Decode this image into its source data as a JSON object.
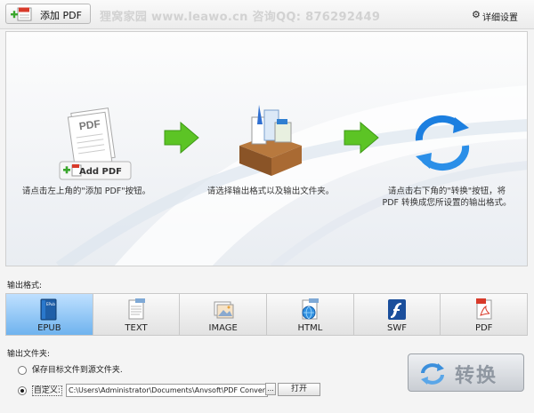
{
  "toolbar": {
    "add_pdf_label": "添加 PDF",
    "watermark": "狸窝家园 www.leawo.cn   咨询QQ: 876292449",
    "settings_label": "详细设置"
  },
  "steps": {
    "step1_icon_label": "Add PDF",
    "step1_text": "请点击左上角的\"添加 PDF\"按钮。",
    "step2_text": "请选择输出格式以及输出文件夹。",
    "step3_text_line1": "请点击右下角的\"转换\"按钮，将",
    "step3_text_line2": "PDF 转换成您所设置的输出格式。"
  },
  "format": {
    "section_label": "输出格式:",
    "selected": "EPUB",
    "tabs": [
      {
        "label": "EPUB",
        "icon": "epub-book-icon"
      },
      {
        "label": "TEXT",
        "icon": "text-document-icon"
      },
      {
        "label": "IMAGE",
        "icon": "image-icon"
      },
      {
        "label": "HTML",
        "icon": "html-globe-icon"
      },
      {
        "label": "SWF",
        "icon": "flash-icon"
      },
      {
        "label": "PDF",
        "icon": "pdf-document-icon"
      }
    ]
  },
  "output": {
    "section_label": "输出文件夹:",
    "option_same_folder": "保存目标文件到源文件夹.",
    "option_custom": "自定义:",
    "selected_option": "custom",
    "path": "C:\\Users\\Administrator\\Documents\\Anvsoft\\PDF Converter\\output\\",
    "browse_label": "...",
    "open_label": "打开"
  },
  "convert": {
    "label": "转换"
  },
  "colors": {
    "accent_blue": "#6fb3ee",
    "arrow_green": "#5cc425",
    "convert_text": "#8f97a1"
  }
}
